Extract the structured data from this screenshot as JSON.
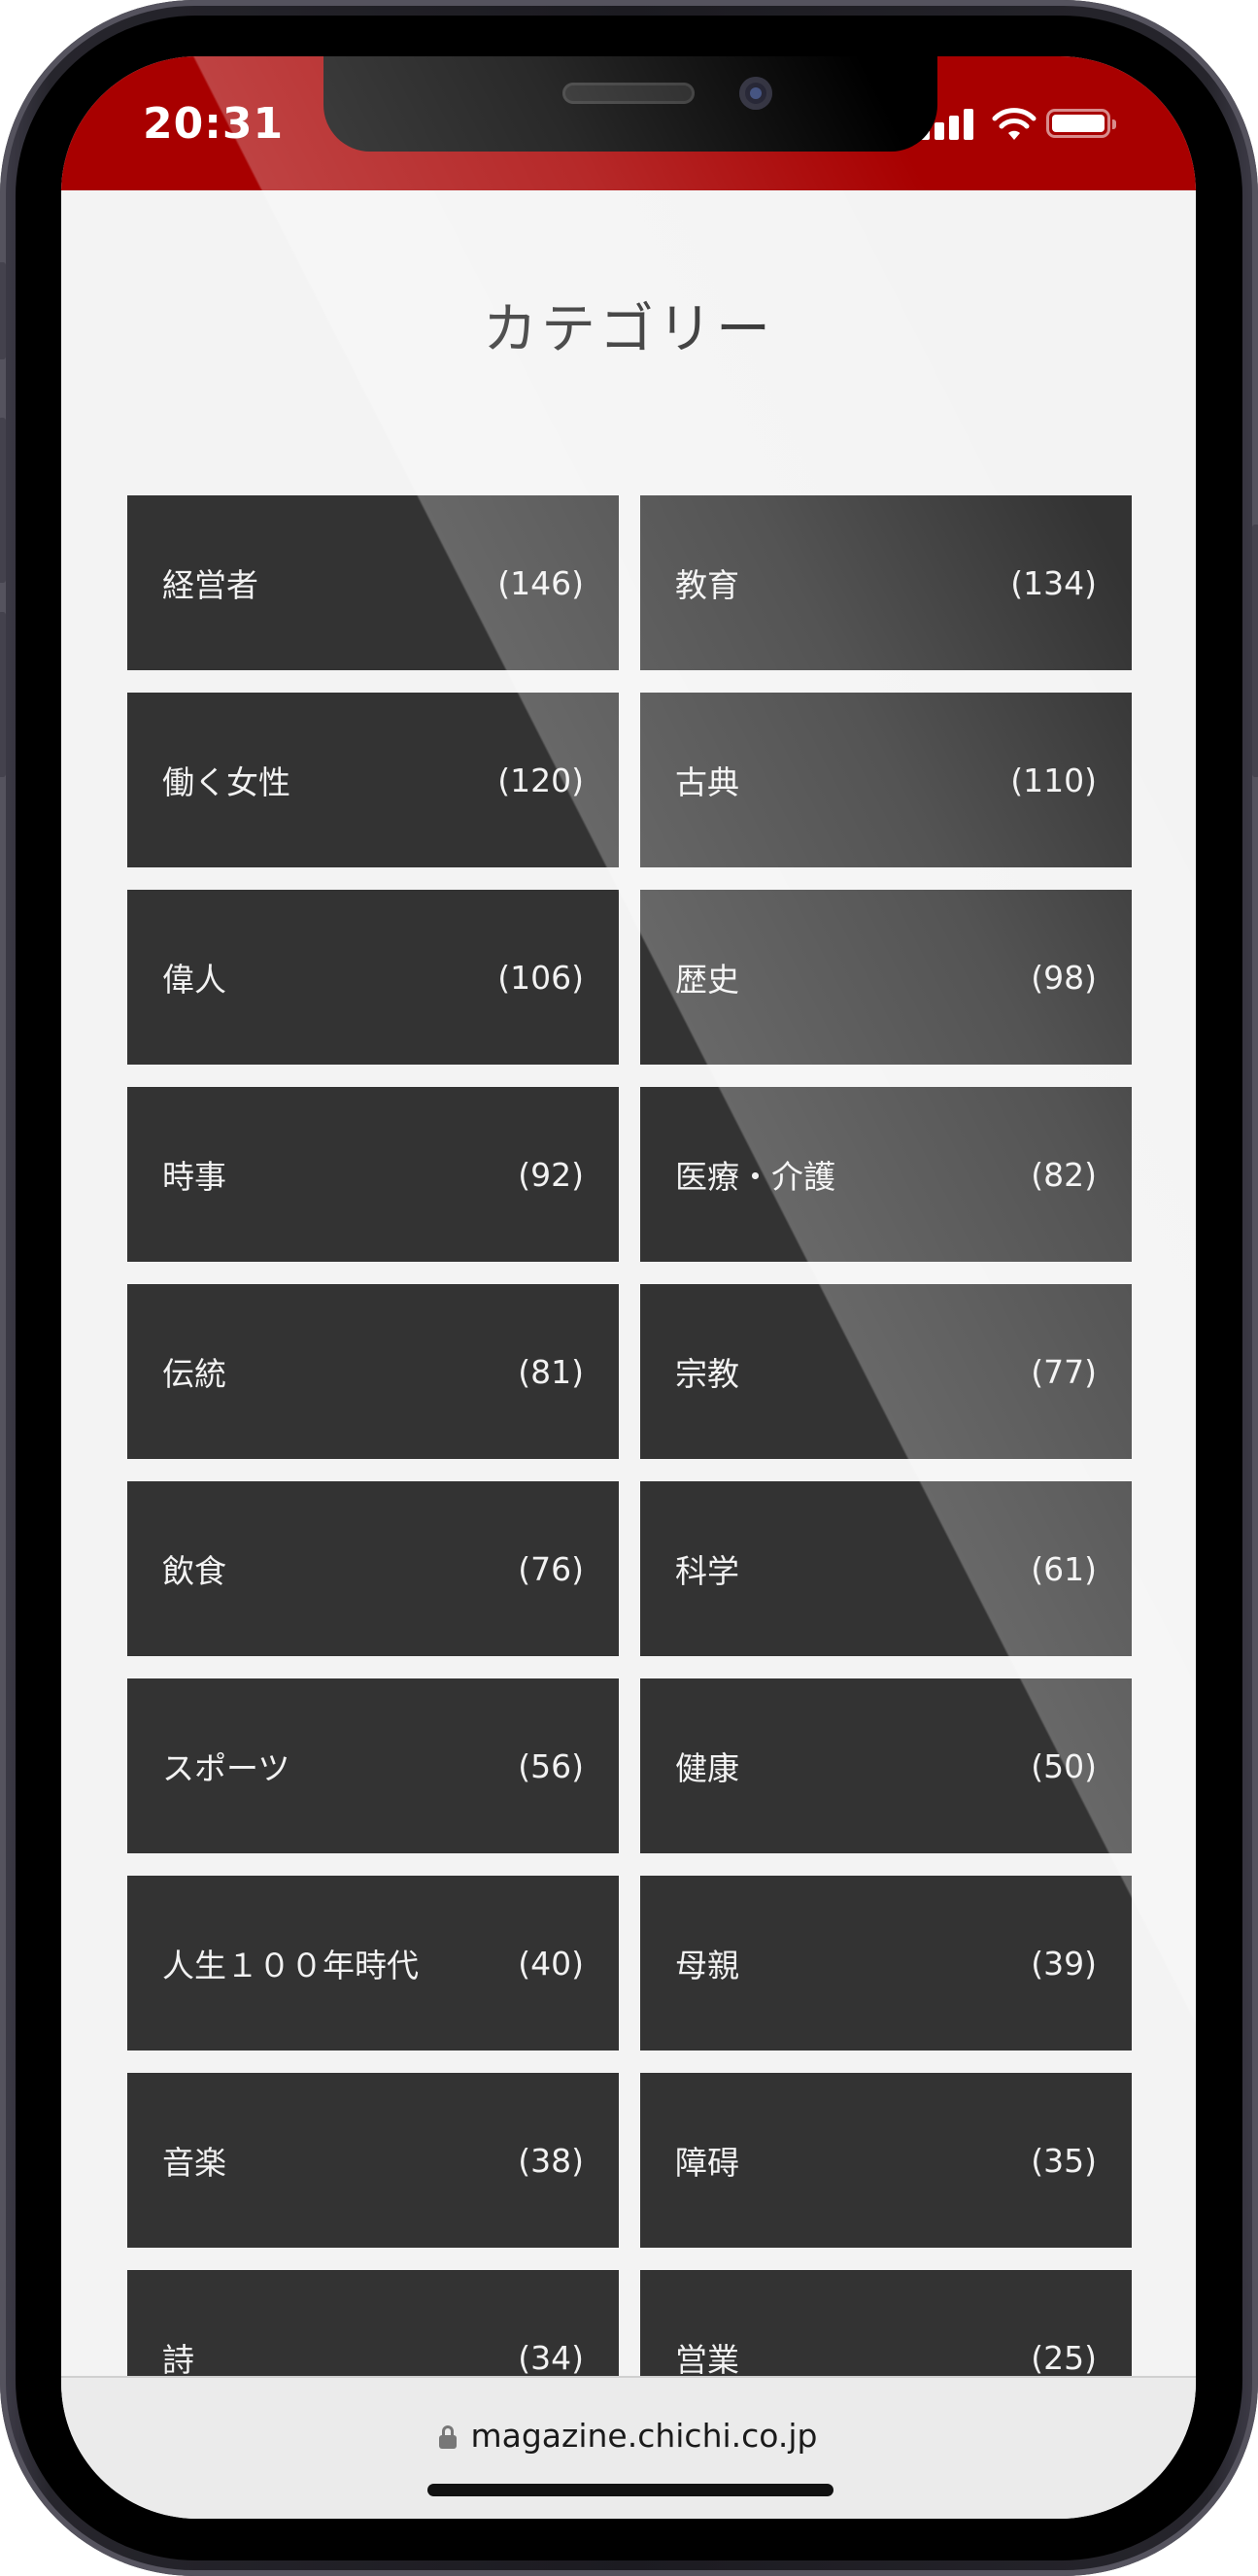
{
  "status_bar": {
    "time": "20:31",
    "signal": "cellular-signal-icon",
    "wifi": "wifi-icon",
    "battery": "battery-icon",
    "battery_level": 1.0,
    "accent_color": "#a80000"
  },
  "page": {
    "title": "カテゴリー"
  },
  "categories": [
    {
      "name": "経営者",
      "count": "(146)"
    },
    {
      "name": "教育",
      "count": "(134)"
    },
    {
      "name": "働く女性",
      "count": "(120)"
    },
    {
      "name": "古典",
      "count": "(110)"
    },
    {
      "name": "偉人",
      "count": "(106)"
    },
    {
      "name": "歴史",
      "count": "(98)"
    },
    {
      "name": "時事",
      "count": "(92)"
    },
    {
      "name": "医療・介護",
      "count": "(82)"
    },
    {
      "name": "伝統",
      "count": "(81)"
    },
    {
      "name": "宗教",
      "count": "(77)"
    },
    {
      "name": "飲食",
      "count": "(76)"
    },
    {
      "name": "科学",
      "count": "(61)"
    },
    {
      "name": "スポーツ",
      "count": "(56)"
    },
    {
      "name": "健康",
      "count": "(50)"
    },
    {
      "name": "人生１００年時代",
      "count": "(40)"
    },
    {
      "name": "母親",
      "count": "(39)"
    },
    {
      "name": "音楽",
      "count": "(38)"
    },
    {
      "name": "障碍",
      "count": "(35)"
    },
    {
      "name": "詩",
      "count": "(34)"
    },
    {
      "name": "営業",
      "count": "(25)"
    }
  ],
  "browser": {
    "url": "magazine.chichi.co.jp",
    "lock_icon": "lock-icon"
  },
  "colors": {
    "tile_background": "#333333",
    "page_background": "#f3f3f3"
  }
}
